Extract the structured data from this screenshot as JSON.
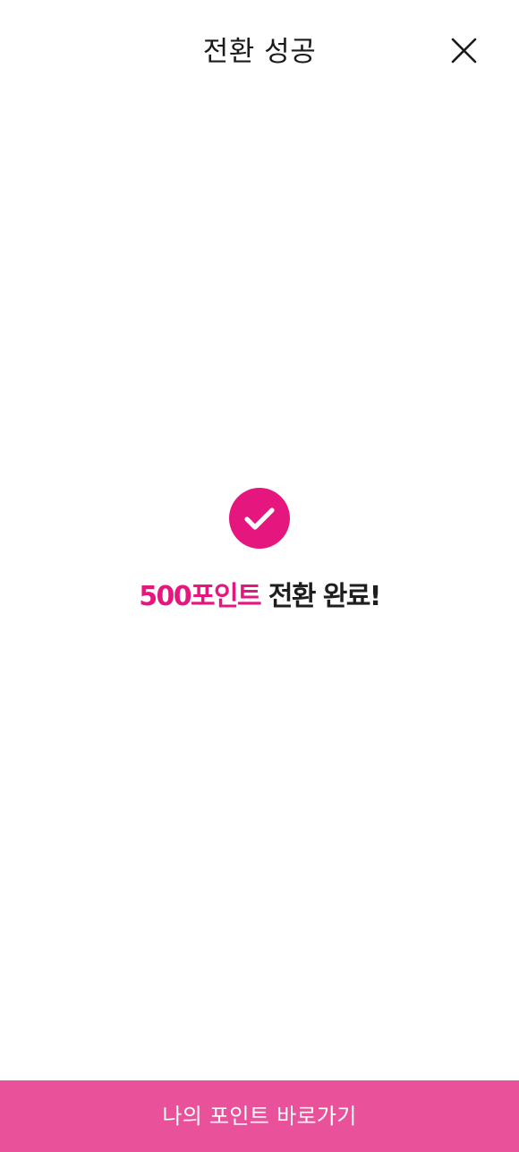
{
  "header": {
    "title": "전환 성공",
    "close_icon": "close-icon"
  },
  "result": {
    "icon": "check-circle-icon",
    "amount_text": "500포인트",
    "message_text": " 전환 완료!"
  },
  "footer": {
    "button_label": "나의 포인트 바로가기"
  },
  "colors": {
    "accent": "#e5177e",
    "button_background": "#ea519b",
    "text": "#1b1b1b",
    "background": "#ffffff"
  }
}
